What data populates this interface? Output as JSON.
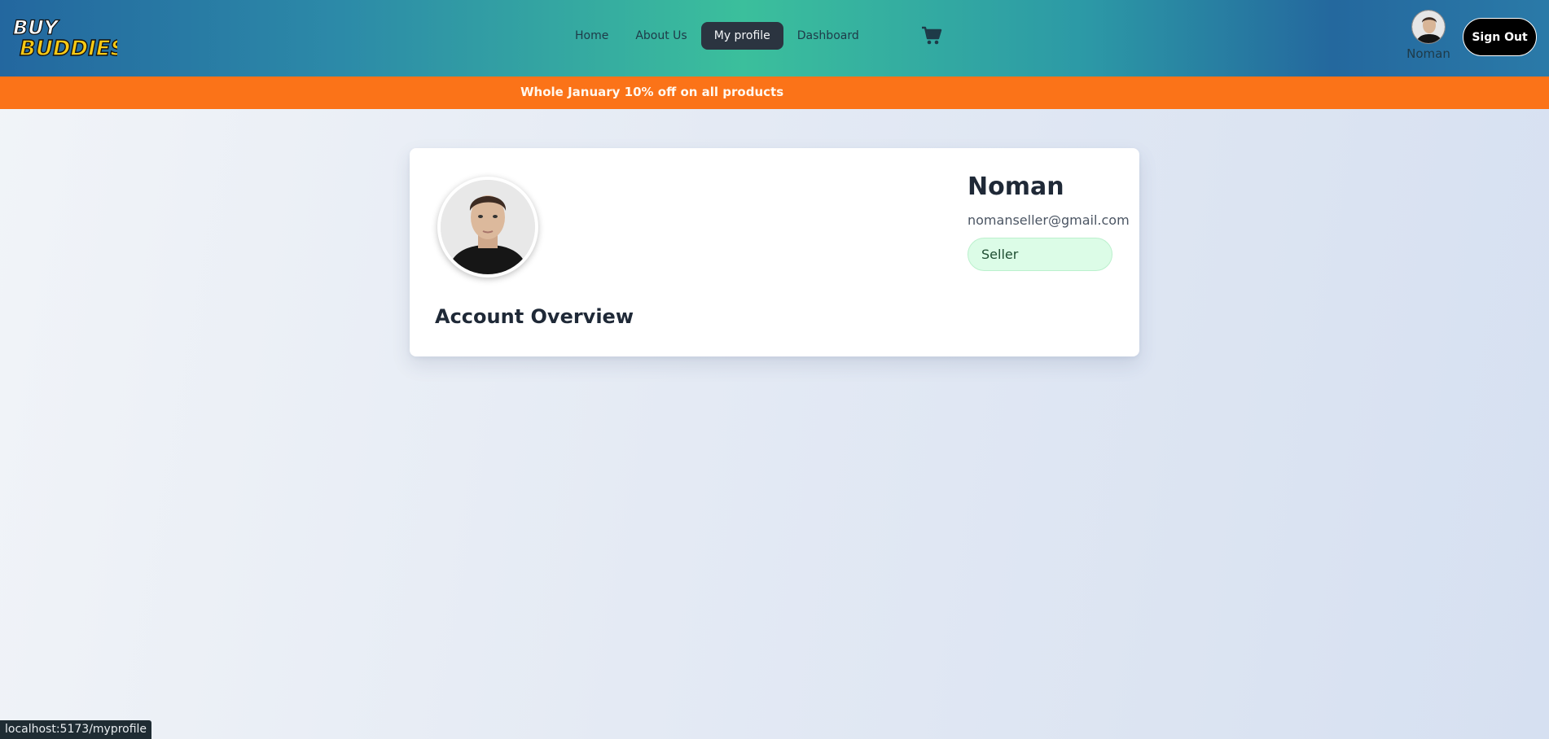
{
  "header": {
    "logo_text_line1": "BUY",
    "logo_text_line2": "BUDDIES",
    "nav": [
      {
        "label": "Home"
      },
      {
        "label": "About Us"
      },
      {
        "label": "My profile",
        "active": true
      },
      {
        "label": "Dashboard"
      }
    ],
    "cart_icon": "cart-icon",
    "user_name": "Noman",
    "signout_label": "Sign Out"
  },
  "promo": {
    "text": "Whole January 10% off on all products"
  },
  "profile": {
    "name": "Noman",
    "email": "nomanseller@gmail.com",
    "role": "Seller",
    "section_title": "Account Overview"
  },
  "status_bar": {
    "url": "localhost:5173/myprofile"
  },
  "colors": {
    "promo": "#fb7318",
    "active_nav": "#2b3440",
    "role_badge": "#dcfce7"
  }
}
